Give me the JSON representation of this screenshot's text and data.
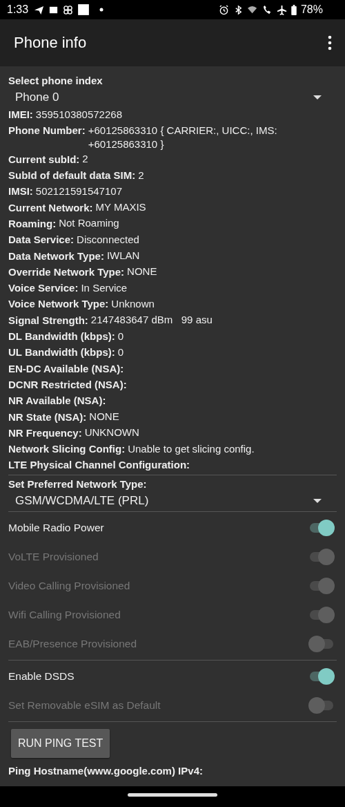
{
  "status_bar": {
    "time": "1:33",
    "battery": "78%"
  },
  "app_bar": {
    "title": "Phone info"
  },
  "phone_index": {
    "label": "Select phone index",
    "value": "Phone 0"
  },
  "info": [
    {
      "label": "IMEI:",
      "value": "359510380572268"
    },
    {
      "label": "Phone Number:",
      "value": "+60125863310 { CARRIER:, UICC:, IMS: +60125863310 }"
    },
    {
      "label": "Current subId:",
      "value": "2"
    },
    {
      "label": "SubId of default data SIM:",
      "value": "2"
    },
    {
      "label": "IMSI:",
      "value": "502121591547107"
    },
    {
      "label": "Current Network:",
      "value": "MY MAXIS"
    },
    {
      "label": "Roaming:",
      "value": "Not Roaming"
    },
    {
      "label": "Data Service:",
      "value": "Disconnected"
    },
    {
      "label": "Data Network Type:",
      "value": "IWLAN"
    },
    {
      "label": "Override Network Type:",
      "value": "NONE"
    },
    {
      "label": "Voice Service:",
      "value": "In Service"
    },
    {
      "label": "Voice Network Type:",
      "value": "Unknown"
    },
    {
      "label": "Signal Strength:",
      "value": "2147483647 dBm   99 asu"
    },
    {
      "label": "DL Bandwidth (kbps):",
      "value": "0"
    },
    {
      "label": "UL Bandwidth (kbps):",
      "value": "0"
    },
    {
      "label": "EN-DC Available (NSA):"
    },
    {
      "label": "DCNR Restricted (NSA):"
    },
    {
      "label": "NR Available (NSA):"
    },
    {
      "label": "NR State (NSA):",
      "value": "NONE"
    },
    {
      "label": "NR Frequency:",
      "value": "UNKNOWN"
    },
    {
      "label": "Network Slicing Config:",
      "value": "Unable to get slicing config."
    },
    {
      "label": "LTE Physical Channel Configuration:"
    }
  ],
  "preferred_network": {
    "label": "Set Preferred Network Type:",
    "value": "GSM/WCDMA/LTE (PRL)"
  },
  "toggle_groups": [
    [
      {
        "label": "Mobile Radio Power",
        "checked": true,
        "disabled": false
      },
      {
        "label": "VoLTE Provisioned",
        "checked": true,
        "disabled": true
      },
      {
        "label": "Video Calling Provisioned",
        "checked": true,
        "disabled": true
      },
      {
        "label": "Wifi Calling Provisioned",
        "checked": true,
        "disabled": true
      },
      {
        "label": "EAB/Presence Provisioned",
        "checked": false,
        "disabled": true
      }
    ],
    [
      {
        "label": "Enable DSDS",
        "checked": true,
        "disabled": false
      },
      {
        "label": "Set Removable eSIM as Default",
        "checked": false,
        "disabled": true
      }
    ]
  ],
  "ping": {
    "button": "RUN PING TEST",
    "hostname_label": "Ping Hostname(www.google.com) IPv4:"
  }
}
